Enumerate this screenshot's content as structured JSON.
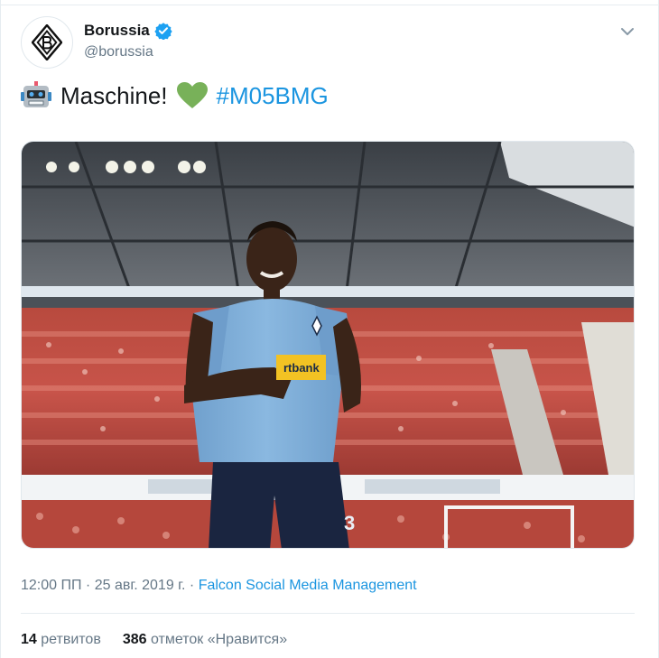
{
  "tweet": {
    "author": {
      "display_name": "Borussia",
      "handle": "@borussia",
      "verified": true,
      "avatar_icon": "borussia-crest-icon"
    },
    "text": {
      "emoji_1": "robot-face-icon",
      "main": "Maschine!",
      "emoji_2": "green-heart-icon",
      "hashtag": "#M05BMG"
    },
    "media": {
      "description_icon": "photo"
    },
    "meta": {
      "time": "12:00 ПП",
      "separator_1": " · ",
      "date": "25 авг. 2019 г.",
      "separator_2": " · ",
      "source": "Falcon Social Media Management"
    },
    "stats": {
      "retweets_count": "14",
      "retweets_label": "ретвитов",
      "likes_count": "386",
      "likes_label": "отметок «Нравится»"
    },
    "colors": {
      "link": "#1b95e0",
      "secondary_text": "#657786",
      "primary_text": "#14171a",
      "verified_badge": "#1da1f2",
      "heart": "#78b159",
      "jersey": "#8ab4dc"
    }
  }
}
